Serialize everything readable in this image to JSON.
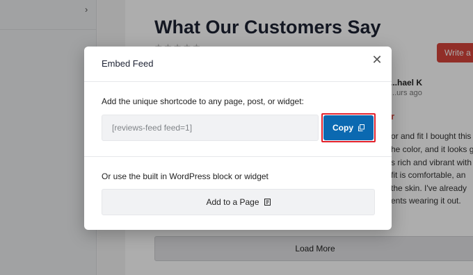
{
  "background": {
    "heading": "What Our Customers Say",
    "stars": "★★★★★",
    "write_button": "Write a Review",
    "review": {
      "author": "...hael K",
      "time": "...urs ago",
      "title_fragment": "r",
      "lines": [
        "or and fit I bought this",
        "he color, and it looks g",
        "s rich and vibrant with",
        "fit is comfortable, an",
        "the skin. I've already",
        "ents wearing it out."
      ]
    },
    "load_more": "Load More"
  },
  "modal": {
    "title": "Embed Feed",
    "close_glyph": "✕",
    "shortcode_label": "Add the unique shortcode to any page, post, or widget:",
    "shortcode_value": "[reviews-feed feed=1]",
    "copy_label": "Copy",
    "block_label": "Or use the built in WordPress block or widget",
    "add_page_label": "Add to a Page"
  },
  "colors": {
    "copy_button": "#0b69b1",
    "highlight_outline": "#e2202a",
    "write_button": "#d6453b"
  },
  "icons": [
    "chevron-right-icon",
    "close-icon",
    "copy-icon",
    "add-page-icon"
  ]
}
